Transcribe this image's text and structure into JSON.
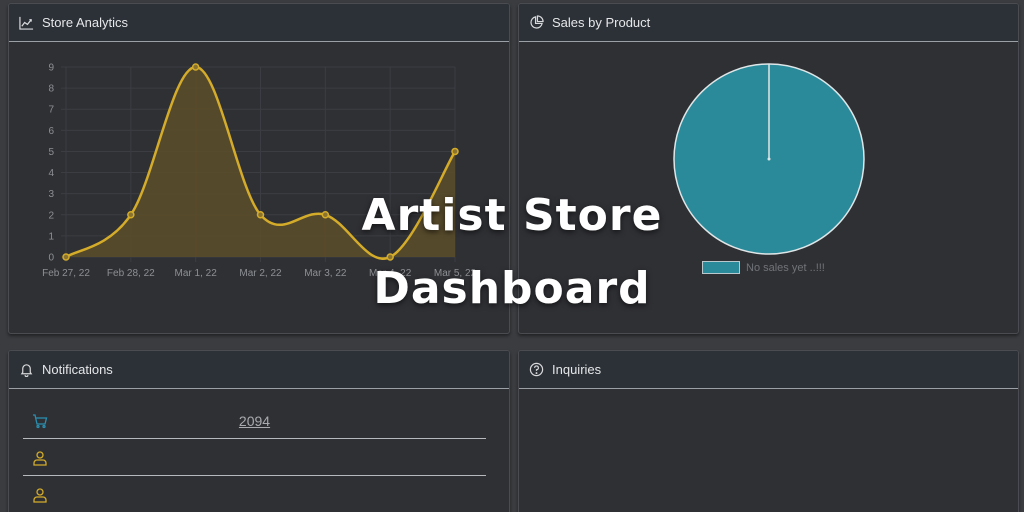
{
  "cards": {
    "analytics": {
      "title": "Store Analytics",
      "icon": "line-chart-icon"
    },
    "sales": {
      "title": "Sales by Product",
      "icon": "pie-chart-icon"
    },
    "notifications": {
      "title": "Notifications",
      "icon": "bell-icon"
    },
    "inquiries": {
      "title": "Inquiries",
      "icon": "question-circle-icon"
    }
  },
  "chart_data": [
    {
      "type": "area",
      "categories": [
        "Feb 27, 22",
        "Feb 28, 22",
        "Mar 1, 22",
        "Mar 2, 22",
        "Mar 3, 22",
        "Mar 4, 22",
        "Mar 5, 22"
      ],
      "values": [
        0,
        2,
        9,
        2,
        2,
        0,
        5
      ],
      "ylim": [
        0,
        9
      ],
      "yticks": [
        0,
        1,
        2,
        3,
        4,
        5,
        6,
        7,
        8,
        9
      ],
      "grid": true,
      "line_color": "#d4ac2a",
      "fill_color": "#5a4d2a"
    },
    {
      "type": "pie",
      "labels": [
        "No sales yet ..!!!"
      ],
      "values": [
        1
      ],
      "colors": [
        "#2a8a99"
      ],
      "legend": "bottom"
    }
  ],
  "notifications": {
    "items": [
      {
        "icon": "cart-icon",
        "value": "2094",
        "icon_color": "#2a8fb0"
      },
      {
        "icon": "user-icon",
        "value": "",
        "icon_color": "#d4ac2a"
      },
      {
        "icon": "user-icon",
        "value": "",
        "icon_color": "#d4ac2a"
      }
    ]
  },
  "overlay": {
    "line1": "Artist Store",
    "line2": "Dashboard"
  }
}
